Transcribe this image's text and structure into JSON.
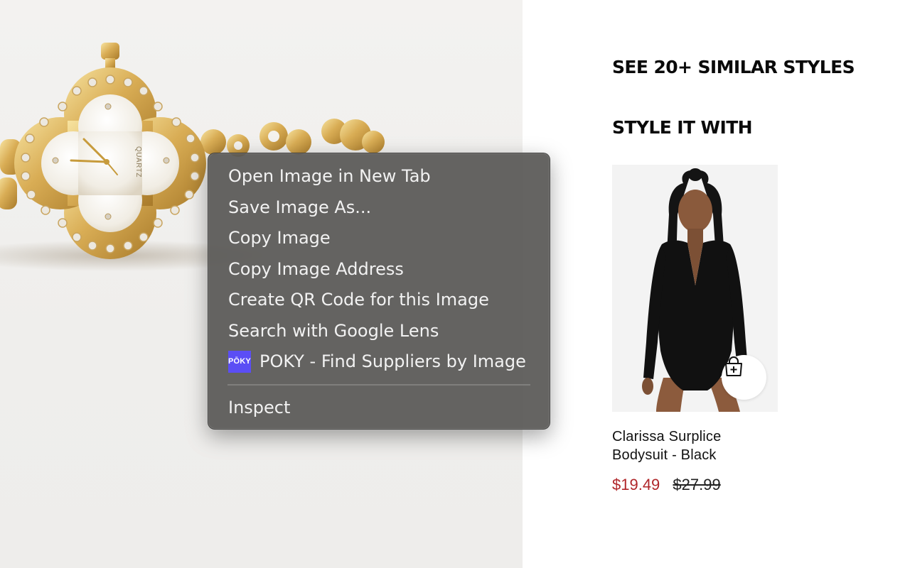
{
  "product_image": {
    "alt": "gold quatrefoil watch",
    "dial_text": "QUARTZ"
  },
  "headings": {
    "similar": "SEE 20+ SIMILAR STYLES",
    "style_it": "STYLE IT WITH"
  },
  "product": {
    "name_line1": "Clarissa Surplice",
    "name_line2": "Bodysuit - Black",
    "sale_price": "$19.49",
    "original_price": "$27.99",
    "bag_icon": "shopping-bag-plus-icon"
  },
  "context_menu": {
    "items": [
      {
        "label": "Open Image in New Tab"
      },
      {
        "label": "Save Image As..."
      },
      {
        "label": "Copy Image"
      },
      {
        "label": "Copy Image Address"
      },
      {
        "label": "Create QR Code for this Image"
      },
      {
        "label": "Search with Google Lens"
      },
      {
        "label": "POKY - Find Suppliers by Image",
        "icon_text": "PŌKY"
      }
    ],
    "inspect": {
      "label": "Inspect"
    }
  },
  "colors": {
    "sale": "#b0262a",
    "menu_bg": "#585755",
    "poky_brand": "#5b4ef5"
  }
}
